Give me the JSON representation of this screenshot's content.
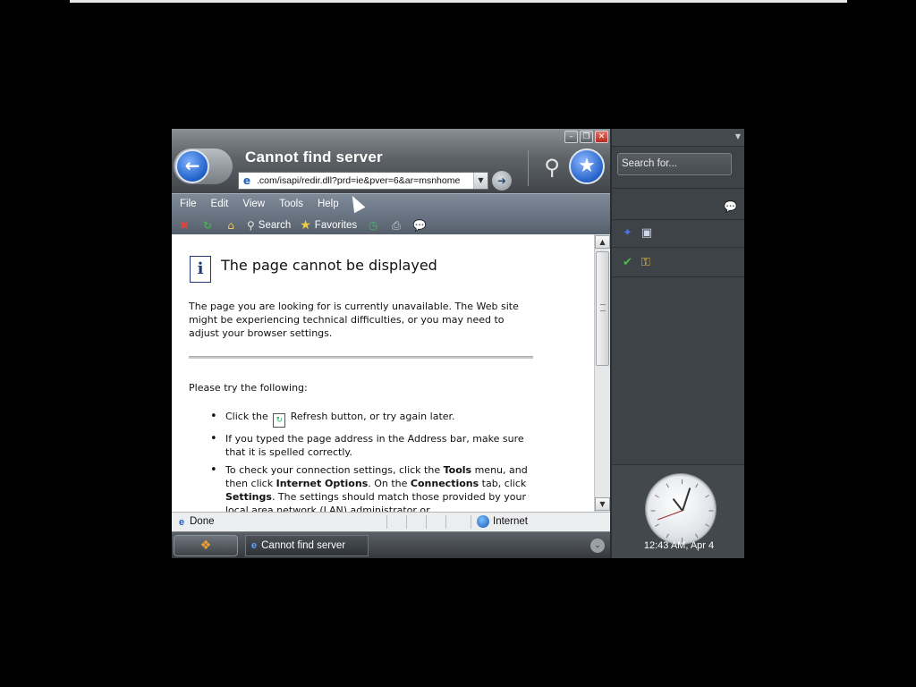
{
  "window": {
    "title": "Cannot find server",
    "address": ".com/isapi/redir.dll?prd=ie&pver=6&ar=msnhome",
    "controls": {
      "minimize": "–",
      "restore": "❐",
      "close": "✕"
    }
  },
  "menubar": [
    "File",
    "Edit",
    "View",
    "Tools",
    "Help"
  ],
  "toolbar": {
    "search_label": "Search",
    "favorites_label": "Favorites",
    "icons": [
      "stop-icon",
      "refresh-icon",
      "home-icon",
      "search-icon",
      "favorites-icon",
      "history-icon",
      "print-icon",
      "messenger-icon"
    ]
  },
  "page": {
    "heading": "The page cannot be displayed",
    "intro": "The page you are looking for is currently unavailable. The Web site might be experiencing technical difficulties, or you may need to adjust your browser settings.",
    "try_label": "Please try the following:",
    "bullet1_pre": "Click the ",
    "bullet1_post": " Refresh button, or try again later.",
    "bullet2": "If you typed the page address in the Address bar, make sure that it is spelled correctly.",
    "bullet3_a": "To check your connection settings, click the ",
    "bullet3_b": "Tools",
    "bullet3_c": " menu, and then click ",
    "bullet3_d": "Internet Options",
    "bullet3_e": ". On the ",
    "bullet3_f": "Connections",
    "bullet3_g": " tab, click ",
    "bullet3_h": "Settings",
    "bullet3_i": ". The settings should match those provided by your local area network (LAN) administrator or"
  },
  "status": {
    "text": "Done",
    "zone": "Internet"
  },
  "taskbar": {
    "task_label": "Cannot find server"
  },
  "sidebar": {
    "search_placeholder": "Search for...",
    "clock_label": "12:43 AM, Apr 4"
  },
  "colors": {
    "accent_blue": "#2563c9",
    "toolbar_bg": "#6a7482",
    "sidebar_bg": "#3e4348"
  }
}
